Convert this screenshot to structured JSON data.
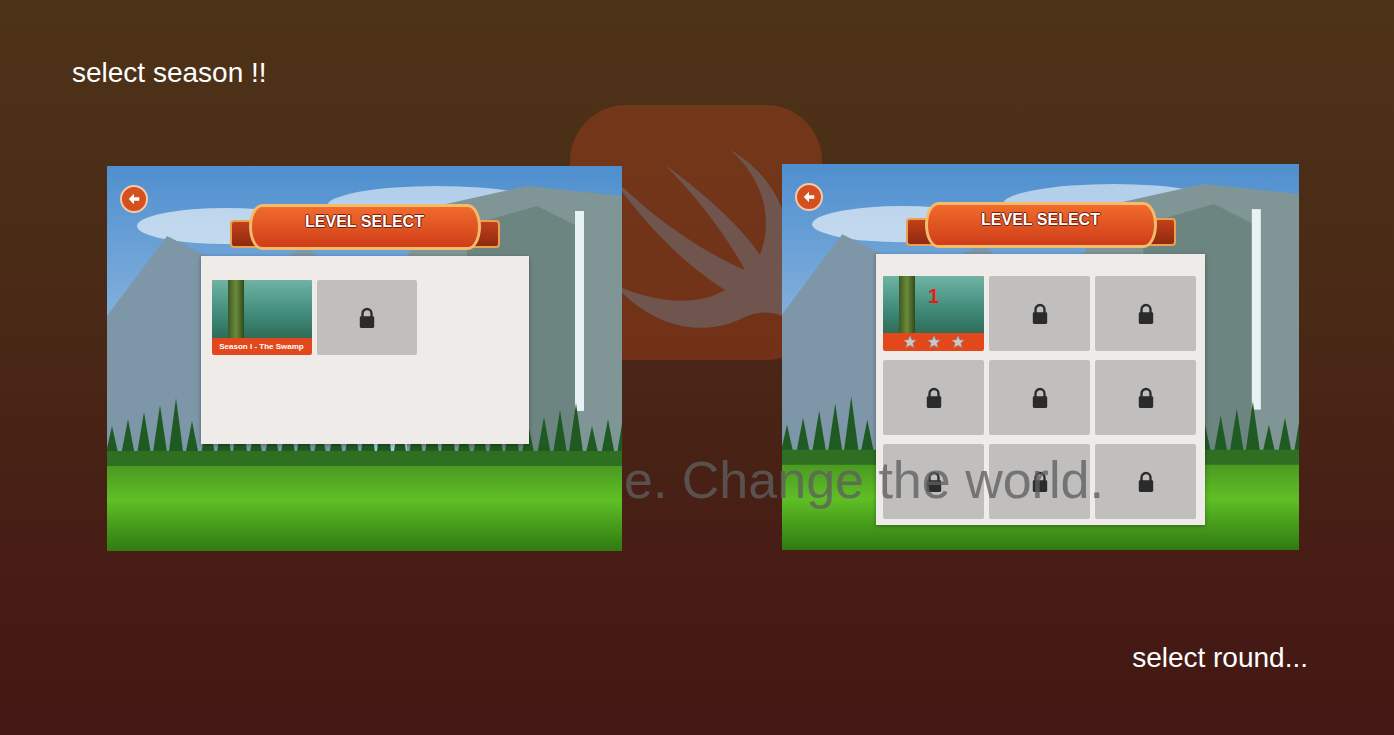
{
  "labels": {
    "top": "select season !!",
    "bottom": "select round..."
  },
  "watermark": {
    "text": "e. Change the world."
  },
  "screens": [
    {
      "title": "LEVEL SELECT",
      "kind": "seasons",
      "items": [
        {
          "label": "Season I - The Swamp",
          "locked": false
        },
        {
          "locked": true
        }
      ]
    },
    {
      "title": "LEVEL SELECT",
      "kind": "rounds",
      "items": [
        {
          "label": "1",
          "locked": false,
          "stars": 0,
          "stars_total": 3
        },
        {
          "locked": true
        },
        {
          "locked": true
        },
        {
          "locked": true
        },
        {
          "locked": true
        },
        {
          "locked": true
        },
        {
          "locked": true
        },
        {
          "locked": true
        },
        {
          "locked": true
        }
      ]
    }
  ]
}
